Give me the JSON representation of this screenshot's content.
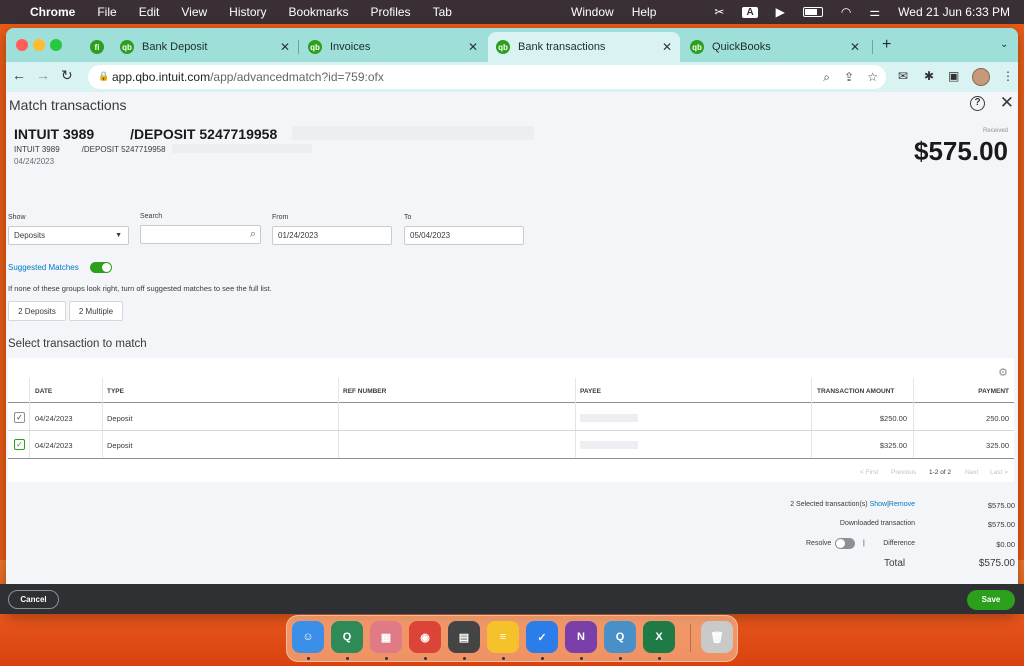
{
  "menubar": {
    "app_name": "Chrome",
    "items": [
      "File",
      "Edit",
      "View",
      "History",
      "Bookmarks",
      "Profiles",
      "Tab",
      "Window",
      "Help"
    ],
    "status_icons": [
      "scissors-icon",
      "input-source-icon",
      "play-circle-icon",
      "battery-icon",
      "wifi-icon",
      "control-center-icon"
    ],
    "input_source": "A",
    "clock": "Wed 21 Jun  6:33 PM"
  },
  "browser": {
    "tabs": [
      {
        "label": "Bank Deposit",
        "active": false
      },
      {
        "label": "Invoices",
        "active": false
      },
      {
        "label": "Bank transactions",
        "active": true
      },
      {
        "label": "QuickBooks",
        "active": false
      }
    ],
    "pinned_tab_icon": "fi",
    "new_tab_glyph": "+",
    "url_host": "app.qbo.intuit.com",
    "url_path": "/app/advancedmatch?id=759:ofx"
  },
  "page": {
    "title": "Match transactions",
    "help_glyph": "?",
    "close_glyph": "✕",
    "transaction": {
      "name_part1": "INTUIT 3989",
      "name_part2": "/DEPOSIT 5247719958",
      "sub_part1": "INTUIT 3989",
      "sub_part2": "/DEPOSIT 5247719958",
      "date": "04/24/2023",
      "received_label": "Received",
      "amount": "$575.00"
    },
    "filters": {
      "show_label": "Show",
      "show_value": "Deposits",
      "search_label": "Search",
      "search_value": "",
      "from_label": "From",
      "from_value": "01/24/2023",
      "to_label": "To",
      "to_value": "05/04/2023"
    },
    "suggested": {
      "label": "Suggested Matches",
      "enabled": true,
      "hint": "If none of these groups look right, turn off suggested matches to see the full list.",
      "groups": [
        "2 Deposits",
        "2 Multiple"
      ]
    },
    "select_heading": "Select transaction to match",
    "table": {
      "columns": [
        "DATE",
        "TYPE",
        "REF NUMBER",
        "PAYEE",
        "TRANSACTION AMOUNT",
        "PAYMENT"
      ],
      "rows": [
        {
          "checked": true,
          "date": "04/24/2023",
          "type": "Deposit",
          "ref": "",
          "amount": "$250.00",
          "payment": "250.00"
        },
        {
          "checked": true,
          "date": "04/24/2023",
          "type": "Deposit",
          "ref": "",
          "amount": "$325.00",
          "payment": "325.00"
        }
      ],
      "pagination": {
        "first": "< First",
        "previous": "Previous",
        "count": "1-2 of 2",
        "next": "Next",
        "last": "Last >"
      }
    },
    "summary": {
      "selected_label": "2 Selected transaction(s)",
      "show_link": "Show",
      "separator": "|",
      "remove_link": "Remove",
      "selected_value": "$575.00",
      "downloaded_label": "Downloaded transaction",
      "downloaded_value": "$575.00",
      "resolve_label": "Resolve",
      "resolve_enabled": false,
      "pipe": "|",
      "difference_label": "Difference",
      "difference_value": "$0.00",
      "total_label": "Total",
      "total_value": "$575.00"
    },
    "footer": {
      "cancel": "Cancel",
      "save": "Save"
    }
  },
  "dock": {
    "apps": [
      {
        "name": "finder",
        "glyph": "☺",
        "color": "#3b8fe8"
      },
      {
        "name": "quran",
        "glyph": "Q",
        "color": "#2e8b57"
      },
      {
        "name": "launchpad",
        "glyph": "▦",
        "color": "#e07b86"
      },
      {
        "name": "chrome",
        "glyph": "◉",
        "color": "#db4437"
      },
      {
        "name": "calculator",
        "glyph": "▤",
        "color": "#444444"
      },
      {
        "name": "notes",
        "glyph": "≡",
        "color": "#f5c22b"
      },
      {
        "name": "tasks",
        "glyph": "✓",
        "color": "#2b7de9"
      },
      {
        "name": "onenote",
        "glyph": "N",
        "color": "#7b3fa9"
      },
      {
        "name": "quicktime",
        "glyph": "Q",
        "color": "#4a90c8"
      },
      {
        "name": "excel",
        "glyph": "X",
        "color": "#1f7a45"
      },
      {
        "name": "trash",
        "glyph": "🗑",
        "color": "#c9c9c9"
      }
    ]
  }
}
